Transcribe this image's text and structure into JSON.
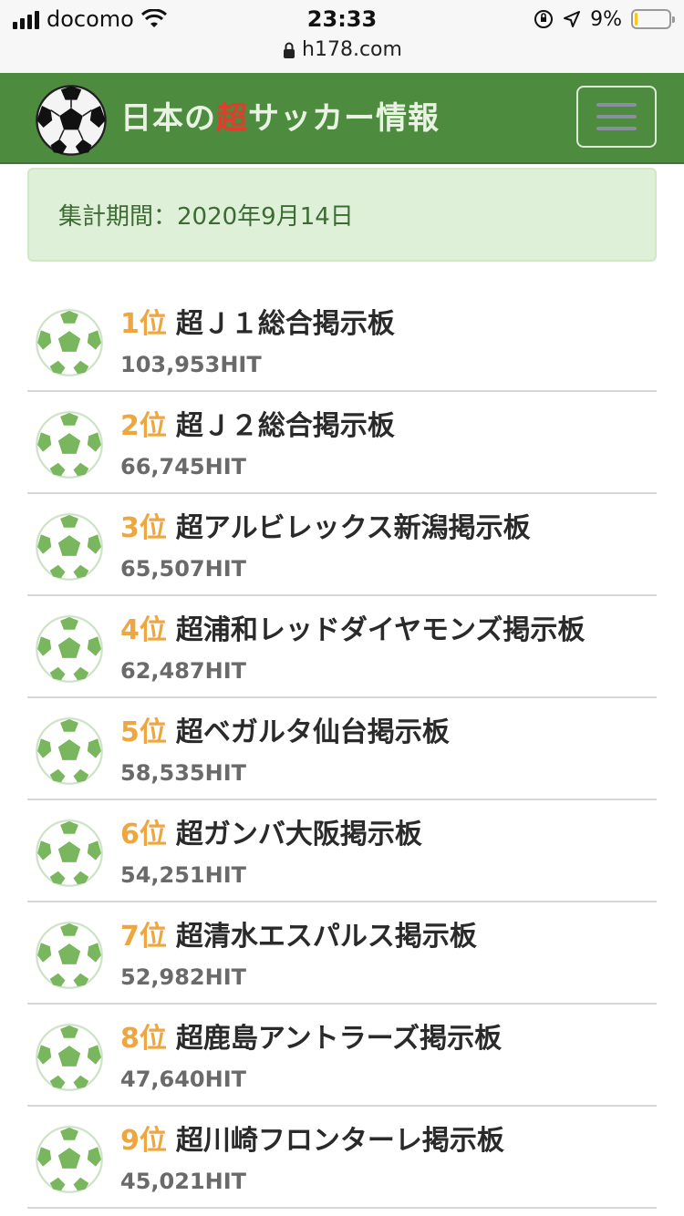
{
  "status_bar": {
    "carrier": "docomo",
    "time": "23:33",
    "battery": "9%",
    "battery_level": 0.09,
    "url": "h178.com"
  },
  "header": {
    "title_prefix": "日本の",
    "title_accent": "超",
    "title_suffix": "サッカー情報",
    "accent_color": "#e53b2e",
    "bar_color": "#4d8b3f"
  },
  "period": {
    "label": "集計期間：2020年9月14日"
  },
  "rankings": [
    {
      "rank": "1位",
      "name": "超Ｊ１総合掲示板",
      "hits": "103,953HIT"
    },
    {
      "rank": "2位",
      "name": "超Ｊ２総合掲示板",
      "hits": "66,745HIT"
    },
    {
      "rank": "3位",
      "name": "超アルビレックス新潟掲示板",
      "hits": "65,507HIT"
    },
    {
      "rank": "4位",
      "name": "超浦和レッドダイヤモンズ掲示板",
      "hits": "62,487HIT"
    },
    {
      "rank": "5位",
      "name": "超ベガルタ仙台掲示板",
      "hits": "58,535HIT"
    },
    {
      "rank": "6位",
      "name": "超ガンバ大阪掲示板",
      "hits": "54,251HIT"
    },
    {
      "rank": "7位",
      "name": "超清水エスパルス掲示板",
      "hits": "52,982HIT"
    },
    {
      "rank": "8位",
      "name": "超鹿島アントラーズ掲示板",
      "hits": "47,640HIT"
    },
    {
      "rank": "9位",
      "name": "超川崎フロンターレ掲示板",
      "hits": "45,021HIT"
    }
  ]
}
